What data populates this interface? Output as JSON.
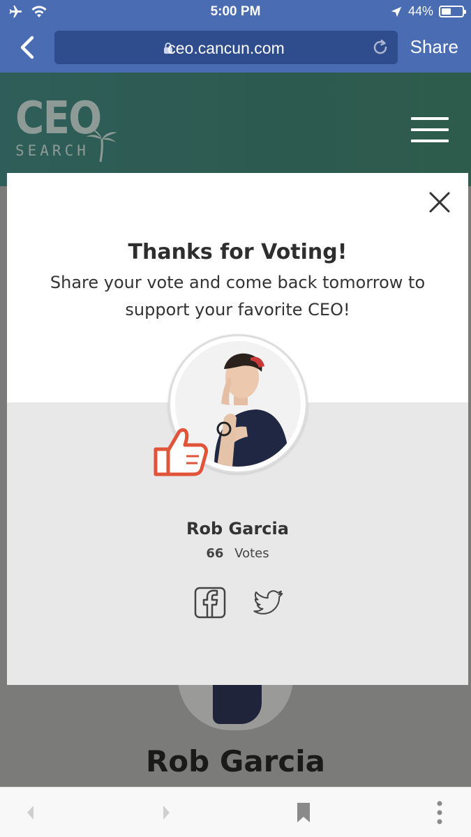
{
  "status_bar": {
    "time": "5:00 PM",
    "battery": "44%"
  },
  "browser": {
    "url": "ceo.cancun.com",
    "share_label": "Share"
  },
  "site": {
    "logo_top": "CEO",
    "logo_bottom": "SEARCH"
  },
  "modal": {
    "title": "Thanks for Voting!",
    "message": "Share your vote and come back tomorrow to support your favorite CEO!",
    "name": "Rob Garcia",
    "vote_count": "66",
    "votes_label": "Votes"
  },
  "background_page": {
    "name": "Rob Garcia"
  },
  "icons": {
    "status": [
      "airplane-icon",
      "wifi-icon",
      "location-arrow-icon",
      "battery-icon"
    ],
    "browser": [
      "back-icon",
      "lock-icon",
      "reload-icon"
    ],
    "social": [
      "facebook-icon",
      "twitter-icon"
    ],
    "toolbar": [
      "nav-back-icon",
      "nav-forward-icon",
      "bookmark-icon",
      "more-icon"
    ]
  },
  "colors": {
    "browser_bar": "#4a6cb3",
    "url_field": "#2f4c8c",
    "site_header": "#2d5a4f",
    "thumb_accent": "#e0553a",
    "modal_lower": "#e8e8e8"
  }
}
